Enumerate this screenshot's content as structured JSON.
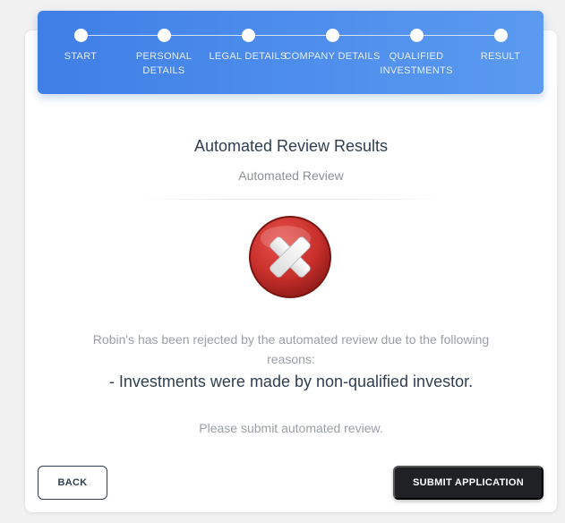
{
  "stepper": {
    "steps": [
      {
        "label": "START"
      },
      {
        "label": "PERSONAL DETAILS"
      },
      {
        "label": "LEGAL DETAILS"
      },
      {
        "label": "COMPANY DETAILS"
      },
      {
        "label": "QUALIFIED INVESTMENTS"
      },
      {
        "label": "RESULT"
      }
    ]
  },
  "content": {
    "title": "Automated Review Results",
    "subtitle": "Automated Review",
    "status_icon": "reject-x-icon",
    "message": "Robin's has been rejected by the automated review due to the following reasons:",
    "reason": "- Investments were made by non-qualified investor.",
    "instruction": "Please submit automated review."
  },
  "actions": {
    "back_label": "BACK",
    "submit_label": "SUBMIT APPLICATION"
  },
  "colors": {
    "stepper_start": "#3f7fe6",
    "stepper_end": "#5b9af0",
    "reject_red": "#c9302c",
    "text_dark": "#2f3e50",
    "button_dark": "#1f2125"
  }
}
